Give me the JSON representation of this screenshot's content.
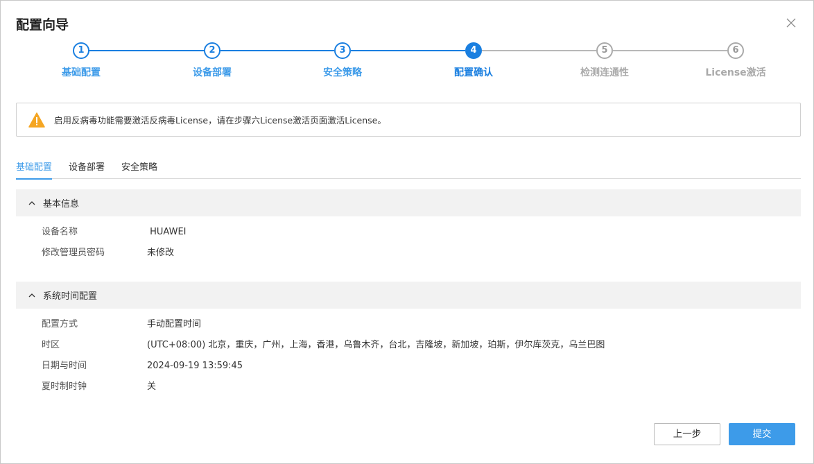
{
  "dialog": {
    "title": "配置向导",
    "close_icon": "close-icon"
  },
  "steps": [
    {
      "number": "1",
      "label": "基础配置",
      "state": "done"
    },
    {
      "number": "2",
      "label": "设备部署",
      "state": "done"
    },
    {
      "number": "3",
      "label": "安全策略",
      "state": "done"
    },
    {
      "number": "4",
      "label": "配置确认",
      "state": "active"
    },
    {
      "number": "5",
      "label": "检测连通性",
      "state": "todo"
    },
    {
      "number": "6",
      "label": "License激活",
      "state": "todo"
    }
  ],
  "alert": {
    "icon": "warning-icon",
    "text": "启用反病毒功能需要激活反病毒License，请在步骤六License激活页面激活License。"
  },
  "tabs": [
    {
      "label": "基础配置",
      "active": true
    },
    {
      "label": "设备部署",
      "active": false
    },
    {
      "label": "安全策略",
      "active": false
    }
  ],
  "sections": [
    {
      "title": "基本信息",
      "expanded": true,
      "rows": [
        {
          "key": "设备名称",
          "value": " HUAWEI"
        },
        {
          "key": "修改管理员密码",
          "value": "未修改"
        }
      ]
    },
    {
      "title": "系统时间配置",
      "expanded": true,
      "rows": [
        {
          "key": "配置方式",
          "value": "手动配置时间"
        },
        {
          "key": "时区",
          "value": "(UTC+08:00) 北京，重庆，广州，上海，香港，乌鲁木齐，台北，吉隆坡，新加坡，珀斯，伊尔库茨克，乌兰巴图"
        },
        {
          "key": "日期与时间",
          "value": "2024-09-19 13:59:45"
        },
        {
          "key": "夏时制时钟",
          "value": "关"
        }
      ]
    }
  ],
  "footer": {
    "prev_label": "上一步",
    "submit_label": "提交"
  },
  "colors": {
    "accent": "#1a7fe0",
    "accent_light": "#3d9be9",
    "inactive": "#aaaaaa",
    "warning": "#f5a623",
    "section_bg": "#f2f2f2"
  }
}
